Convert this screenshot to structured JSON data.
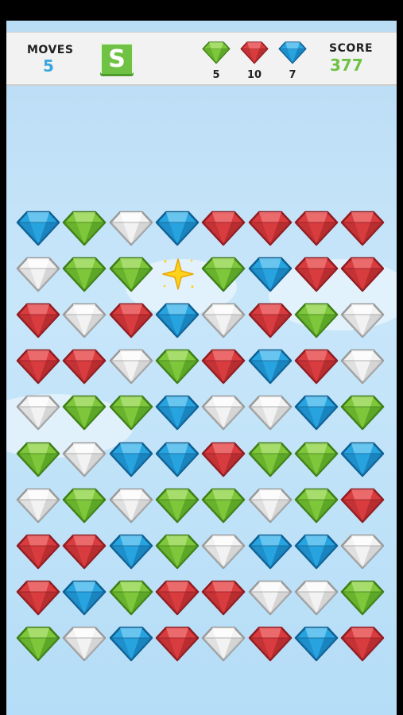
{
  "hud": {
    "moves_label": "MOVES",
    "moves_value": "5",
    "pause_label": "S",
    "score_label": "SCORE",
    "score_value": "377",
    "goals": [
      {
        "gem": "green",
        "count": "5"
      },
      {
        "gem": "red",
        "count": "10"
      },
      {
        "gem": "blue",
        "count": "7"
      }
    ]
  },
  "colors": {
    "moves_value": "#3aa6e0",
    "score_value": "#6fc243",
    "gem_red": "#d93c3f",
    "gem_green": "#7ec63a",
    "gem_blue": "#27a4e0",
    "gem_white": "#f2f2f2"
  },
  "board": {
    "columns": 8,
    "rows": [
      [
        "blue",
        "green",
        "white",
        "blue",
        "red",
        "red",
        "red",
        "red"
      ],
      [
        "white",
        "green",
        "green",
        "sparkle",
        "green",
        "blue",
        "red",
        "red"
      ],
      [
        "red",
        "white",
        "red",
        "blue",
        "white",
        "red",
        "green",
        "white"
      ],
      [
        "red",
        "red",
        "white",
        "green",
        "red",
        "blue",
        "red",
        "white"
      ],
      [
        "white",
        "green",
        "green",
        "blue",
        "white",
        "white",
        "blue",
        "green"
      ],
      [
        "green",
        "white",
        "blue",
        "blue",
        "red",
        "green",
        "green",
        "blue"
      ],
      [
        "white",
        "green",
        "white",
        "green",
        "green",
        "white",
        "green",
        "red"
      ],
      [
        "red",
        "red",
        "blue",
        "green",
        "white",
        "blue",
        "blue",
        "white"
      ],
      [
        "red",
        "blue",
        "green",
        "red",
        "red",
        "white",
        "white",
        "green"
      ],
      [
        "green",
        "white",
        "blue",
        "red",
        "white",
        "red",
        "blue",
        "red"
      ]
    ]
  }
}
